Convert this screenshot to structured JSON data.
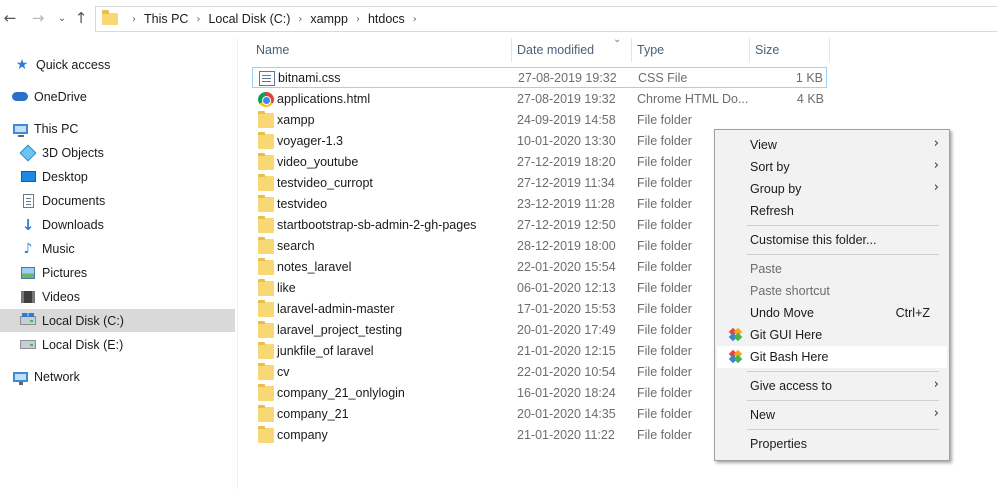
{
  "address_bar": {
    "back_icon": "back-arrow-icon",
    "forward_icon": "forward-arrow-icon",
    "recent_icon": "chevron-down-icon",
    "up_icon": "up-arrow-icon",
    "crumbs": [
      "This PC",
      "Local Disk (C:)",
      "xampp",
      "htdocs"
    ]
  },
  "nav_pane": {
    "items": [
      {
        "label": "Quick access",
        "icon": "star-icon"
      },
      {
        "label": "OneDrive",
        "icon": "cloud-icon"
      },
      {
        "label": "This PC",
        "icon": "computer-icon"
      },
      {
        "label": "3D Objects",
        "icon": "cube-icon"
      },
      {
        "label": "Desktop",
        "icon": "desktop-icon"
      },
      {
        "label": "Documents",
        "icon": "document-icon"
      },
      {
        "label": "Downloads",
        "icon": "download-icon"
      },
      {
        "label": "Music",
        "icon": "music-icon"
      },
      {
        "label": "Pictures",
        "icon": "pictures-icon"
      },
      {
        "label": "Videos",
        "icon": "videos-icon"
      },
      {
        "label": "Local Disk (C:)",
        "icon": "windows-drive-icon"
      },
      {
        "label": "Local Disk (E:)",
        "icon": "drive-icon"
      },
      {
        "label": "Network",
        "icon": "network-icon"
      }
    ]
  },
  "file_list": {
    "columns": {
      "name": "Name",
      "date": "Date modified",
      "type": "Type",
      "size": "Size"
    },
    "rows": [
      {
        "name": "bitnami.css",
        "date": "27-08-2019 19:32",
        "type": "CSS File",
        "size": "1 KB",
        "icon": "css-file-icon"
      },
      {
        "name": "applications.html",
        "date": "27-08-2019 19:32",
        "type": "Chrome HTML Do...",
        "size": "4 KB",
        "icon": "chrome-icon"
      },
      {
        "name": "xampp",
        "date": "24-09-2019 14:58",
        "type": "File folder",
        "size": "",
        "icon": "folder-icon"
      },
      {
        "name": "voyager-1.3",
        "date": "10-01-2020 13:30",
        "type": "File folder",
        "size": "",
        "icon": "folder-icon"
      },
      {
        "name": "video_youtube",
        "date": "27-12-2019 18:20",
        "type": "File folder",
        "size": "",
        "icon": "folder-icon"
      },
      {
        "name": "testvideo_curropt",
        "date": "27-12-2019 11:34",
        "type": "File folder",
        "size": "",
        "icon": "folder-icon"
      },
      {
        "name": "testvideo",
        "date": "23-12-2019 11:28",
        "type": "File folder",
        "size": "",
        "icon": "folder-icon"
      },
      {
        "name": "startbootstrap-sb-admin-2-gh-pages",
        "date": "27-12-2019 12:50",
        "type": "File folder",
        "size": "",
        "icon": "folder-icon"
      },
      {
        "name": "search",
        "date": "28-12-2019 18:00",
        "type": "File folder",
        "size": "",
        "icon": "folder-icon"
      },
      {
        "name": "notes_laravel",
        "date": "22-01-2020 15:54",
        "type": "File folder",
        "size": "",
        "icon": "folder-icon"
      },
      {
        "name": "like",
        "date": "06-01-2020 12:13",
        "type": "File folder",
        "size": "",
        "icon": "folder-icon"
      },
      {
        "name": "laravel-admin-master",
        "date": "17-01-2020 15:53",
        "type": "File folder",
        "size": "",
        "icon": "folder-icon"
      },
      {
        "name": "laravel_project_testing",
        "date": "20-01-2020 17:49",
        "type": "File folder",
        "size": "",
        "icon": "folder-icon"
      },
      {
        "name": "junkfile_of laravel",
        "date": "21-01-2020 12:15",
        "type": "File folder",
        "size": "",
        "icon": "folder-icon"
      },
      {
        "name": "cv",
        "date": "22-01-2020 10:54",
        "type": "File folder",
        "size": "",
        "icon": "folder-icon"
      },
      {
        "name": "company_21_onlylogin",
        "date": "16-01-2020 18:24",
        "type": "File folder",
        "size": "",
        "icon": "folder-icon"
      },
      {
        "name": "company_21",
        "date": "20-01-2020 14:35",
        "type": "File folder",
        "size": "",
        "icon": "folder-icon"
      },
      {
        "name": "company",
        "date": "21-01-2020 11:22",
        "type": "File folder",
        "size": "",
        "icon": "folder-icon"
      }
    ]
  },
  "context_menu": {
    "items": [
      {
        "label": "View",
        "submenu": true
      },
      {
        "label": "Sort by",
        "submenu": true
      },
      {
        "label": "Group by",
        "submenu": true
      },
      {
        "label": "Refresh"
      },
      {
        "label": "Customise this folder..."
      },
      {
        "label": "Paste",
        "disabled": true
      },
      {
        "label": "Paste shortcut",
        "disabled": true
      },
      {
        "label": "Undo Move",
        "shortcut": "Ctrl+Z"
      },
      {
        "label": "Git GUI Here",
        "icon": "git-icon"
      },
      {
        "label": "Git Bash Here",
        "icon": "git-icon"
      },
      {
        "label": "Give access to",
        "submenu": true
      },
      {
        "label": "New",
        "submenu": true
      },
      {
        "label": "Properties"
      }
    ]
  },
  "colors": {
    "selection_border": "#99d1ff",
    "nav_selected_bg": "#d9d9d9",
    "menu_bg": "#f2f2f2",
    "folder": "#f8d775"
  }
}
